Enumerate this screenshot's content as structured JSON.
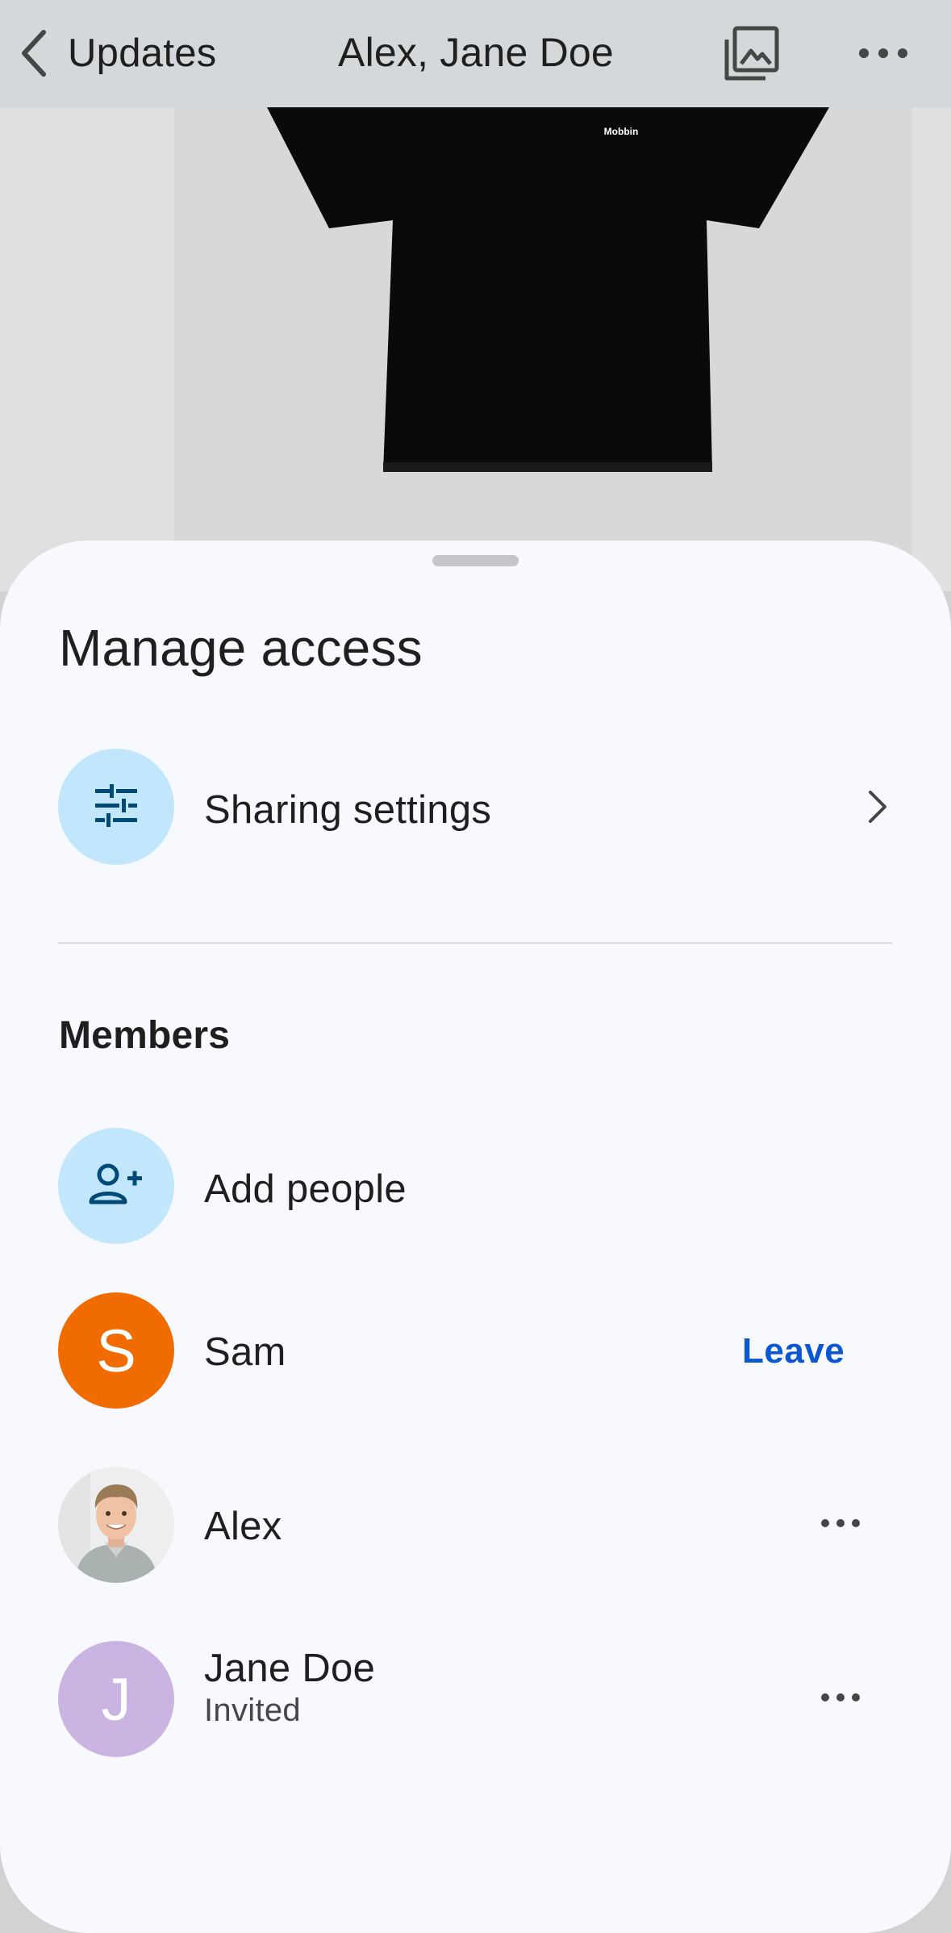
{
  "header": {
    "back_label": "Updates",
    "title": "Alex, Jane Doe"
  },
  "photo": {
    "brand_text": "Mobbin"
  },
  "sheet": {
    "title": "Manage access",
    "sharing_settings_label": "Sharing settings",
    "members_heading": "Members",
    "add_people_label": "Add people",
    "members": [
      {
        "initial": "S",
        "name": "Sam",
        "action": "Leave",
        "avatar_color": "#f06c00"
      },
      {
        "initial": "",
        "name": "Alex",
        "action": "more"
      },
      {
        "initial": "J",
        "name": "Jane Doe",
        "status": "Invited",
        "avatar_color": "#c9b4e2"
      }
    ]
  },
  "colors": {
    "accent": "#0b57d0",
    "icon_chip": "#c2e7fd",
    "icon_dark": "#004a77"
  }
}
